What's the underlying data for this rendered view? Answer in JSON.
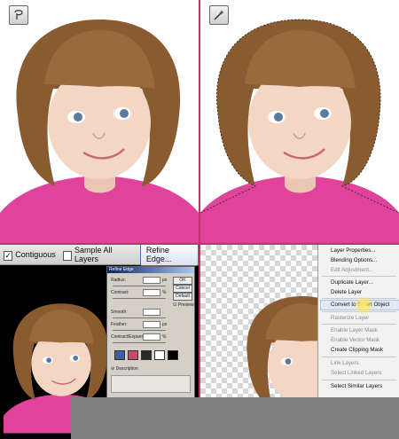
{
  "options_bar": {
    "contiguous_checked": true,
    "contiguous_label": "Contiguous",
    "sample_all_layers_checked": false,
    "sample_all_layers_label": "Sample All Layers",
    "refine_edge_label": "Refine Edge..."
  },
  "refine_dialog": {
    "title": "Refine Edge",
    "fields": [
      {
        "label": "Radius:",
        "value": "",
        "unit": "px"
      },
      {
        "label": "Contrast:",
        "value": "",
        "unit": "%"
      },
      {
        "label": "Smooth:",
        "value": "",
        "unit": ""
      },
      {
        "label": "Feather:",
        "value": "",
        "unit": "px"
      },
      {
        "label": "Contract/Expand:",
        "value": "",
        "unit": "%"
      }
    ],
    "buttons": [
      "OK",
      "Cancel",
      "Default"
    ],
    "preview_label": "Preview",
    "description_label": "Description"
  },
  "context_menu": {
    "items": [
      {
        "label": "Layer Properties...",
        "enabled": true
      },
      {
        "label": "Blending Options...",
        "enabled": true
      },
      {
        "label": "Edit Adjustment...",
        "enabled": false
      },
      {
        "label": "Duplicate Layer...",
        "enabled": true
      },
      {
        "label": "Delete Layer",
        "enabled": true
      },
      {
        "label": "Convert to Smart Object",
        "enabled": true,
        "highlighted": true
      },
      {
        "label": "Rasterize Layer",
        "enabled": false
      },
      {
        "label": "Enable Layer Mask",
        "enabled": false
      },
      {
        "label": "Enable Vector Mask",
        "enabled": false
      },
      {
        "label": "Create Clipping Mask",
        "enabled": true
      },
      {
        "label": "Link Layers",
        "enabled": false
      },
      {
        "label": "Select Linked Layers",
        "enabled": false
      },
      {
        "label": "Select Similar Layers",
        "enabled": true
      }
    ]
  },
  "colors": {
    "divider": "#c2336a",
    "dress": "#e0449a",
    "hair": "#8a5a30",
    "skin": "#f3d6c4"
  },
  "icons": {
    "top_left_tool": "lasso-tool-icon",
    "top_right_tool": "magic-wand-tool-icon"
  }
}
